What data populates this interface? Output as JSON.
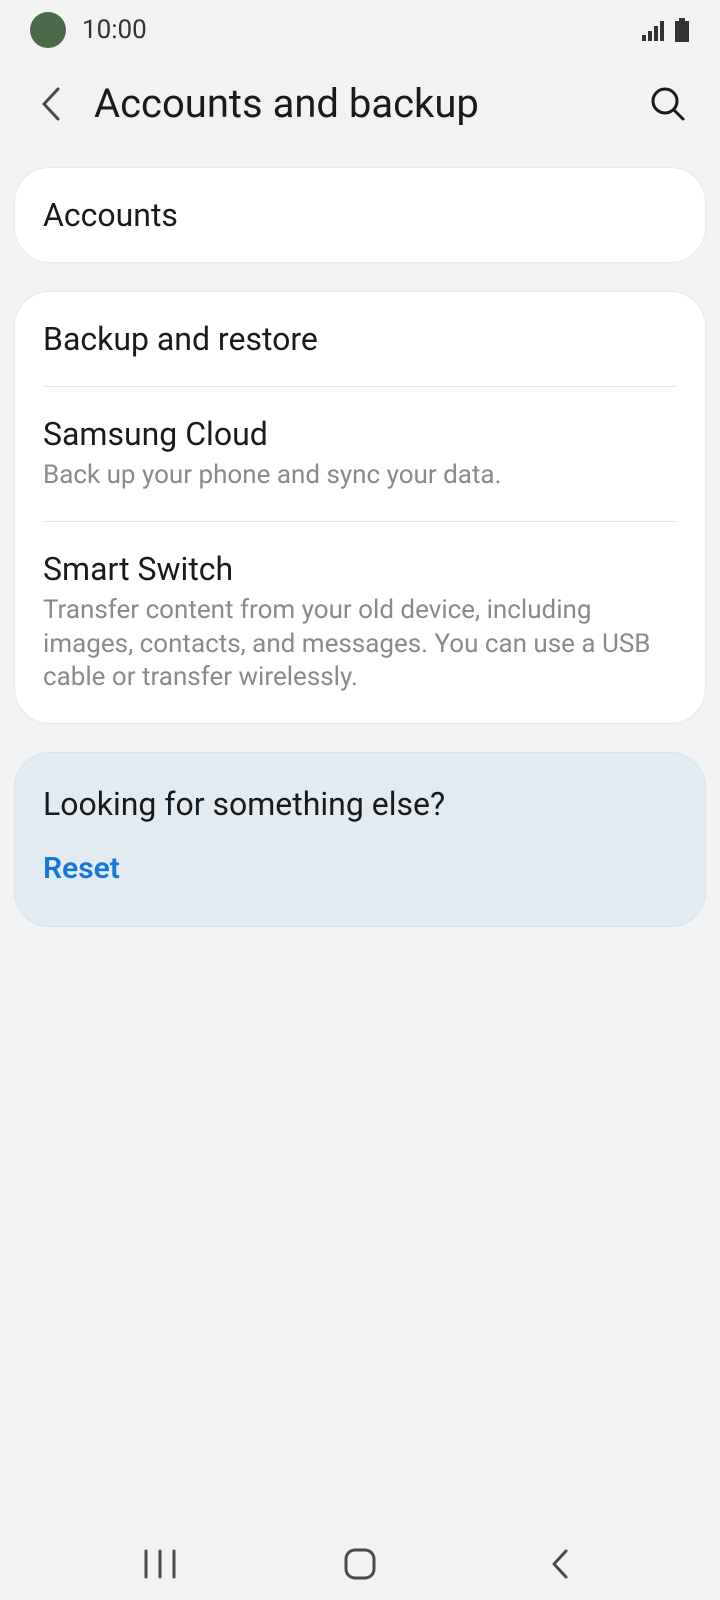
{
  "status": {
    "time": "10:00"
  },
  "header": {
    "title": "Accounts and backup"
  },
  "sections": [
    {
      "items": [
        {
          "title": "Accounts"
        }
      ]
    },
    {
      "items": [
        {
          "title": "Backup and restore"
        },
        {
          "title": "Samsung Cloud",
          "subtitle": "Back up your phone and sync your data."
        },
        {
          "title": "Smart Switch",
          "subtitle": "Transfer content from your old device, including images, contacts, and messages. You can use a USB cable or transfer wirelessly."
        }
      ]
    }
  ],
  "footer": {
    "title": "Looking for something else?",
    "link": "Reset"
  }
}
